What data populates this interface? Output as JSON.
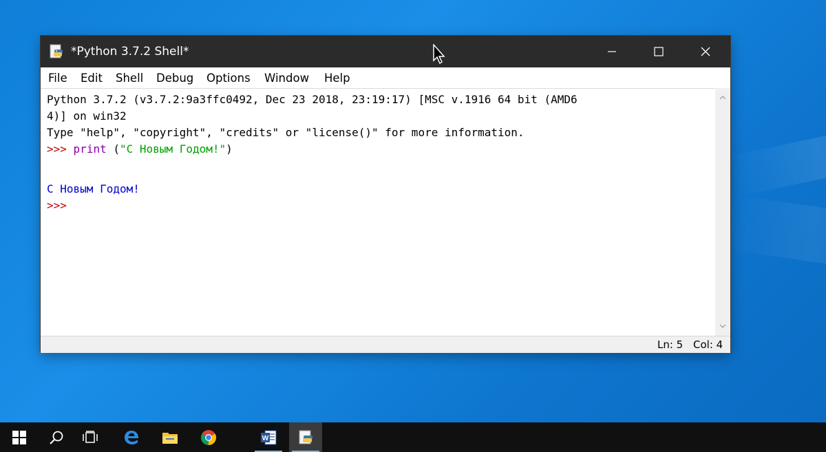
{
  "window": {
    "title": "*Python 3.7.2 Shell*",
    "app_icon": "python-idle-icon",
    "controls": [
      "minimize-icon",
      "maximize-icon",
      "close-icon"
    ]
  },
  "menu": {
    "items": [
      "File",
      "Edit",
      "Shell",
      "Debug",
      "Options",
      "Window",
      "Help"
    ]
  },
  "editor": {
    "banner_line1": "Python 3.7.2 (v3.7.2:9a3ffc0492, Dec 23 2018, 23:19:17) [MSC v.1916 64 bit (AMD6",
    "banner_line2": "4)] on win32",
    "banner_line3": "Type \"help\", \"copyright\", \"credits\" or \"license()\" for more information.",
    "prompt": ">>>",
    "command_keyword": "print",
    "command_open": "(",
    "command_string": "\"С Новым Годом!\"",
    "command_close": ")",
    "output": "С Новым Годом!",
    "prompt2": ">>>"
  },
  "status": {
    "line": "Ln: 5",
    "col": "Col: 4"
  },
  "colors": {
    "titlebar": "#2b2b2b",
    "prompt": "#c00000",
    "keyword": "#8a00a8",
    "string": "#00a000",
    "output": "#0000d0",
    "taskbar": "#101010",
    "desktop": "#1a8ee8"
  },
  "taskbar": {
    "items": [
      "start-windows-icon",
      "search-icon",
      "task-view-icon",
      "edge-icon",
      "file-explorer-icon",
      "chrome-icon",
      "word-icon",
      "python-idle-taskbar-icon"
    ],
    "active": "python-idle-taskbar-icon"
  }
}
